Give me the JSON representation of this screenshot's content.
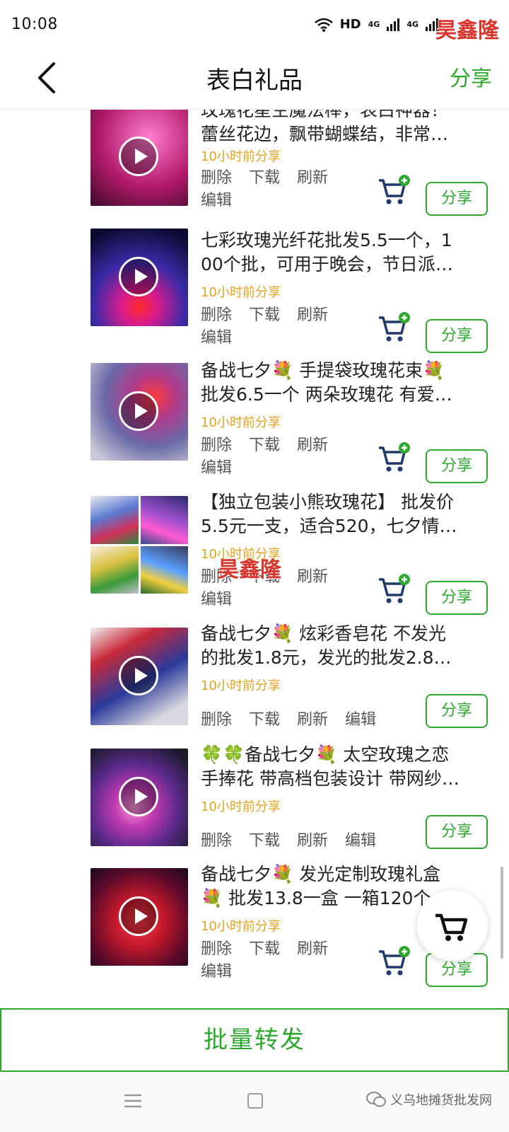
{
  "status_bar": {
    "time": "10:08",
    "network": "HD",
    "signal1": "4G",
    "signal2": "4G",
    "watermark": "昊鑫隆"
  },
  "nav": {
    "title": "表白礼品",
    "share": "分享"
  },
  "labels": {
    "delete": "删除",
    "download": "下载",
    "refresh": "刷新",
    "edit": "编辑",
    "share": "分享"
  },
  "items": [
    {
      "line1": "玫瑰花星空魔法棒，表白神器！",
      "line2": "蕾丝花边，飘带蝴蝶结，非常…",
      "time": "10小时前分享"
    },
    {
      "line1": "七彩玫瑰光纤花批发5.5一个，1",
      "line2": "00个批，可用于晚会，节日派…",
      "time": "10小时前分享"
    },
    {
      "line1": "备战七夕💐 手提袋玫瑰花束💐",
      "line2": "批发6.5一个 两朵玫瑰花 有爱…",
      "time": "10小时前分享"
    },
    {
      "line1": "【独立包装小熊玫瑰花】 批发价",
      "line2": "5.5元一支，适合520，七夕情…",
      "time": "10小时前分享"
    },
    {
      "line1": "备战七夕💐 炫彩香皂花 不发光",
      "line2": "的批发1.8元，发光的批发2.8…",
      "time": "10小时前分享"
    },
    {
      "line1": "🍀🍀备战七夕💐 太空玫瑰之恋",
      "line2": "手捧花 带高档包装设计 带网纱…",
      "time": "10小时前分享"
    },
    {
      "line1": "备战七夕💐 发光定制玫瑰礼盒",
      "line2": "💐 批发13.8一盒 一箱120个 ...",
      "time": "10小时前分享"
    }
  ],
  "watermark_mid": "昊鑫隆",
  "batch_button": "批量转发",
  "footer_watermark": "义乌地摊货批发网",
  "colors": {
    "accent": "#2ea82e",
    "time_text": "#e5a21b",
    "cart_icon": "#1f3a6b",
    "cart_plus": "#2ea82e",
    "watermark": "#d8362c"
  }
}
